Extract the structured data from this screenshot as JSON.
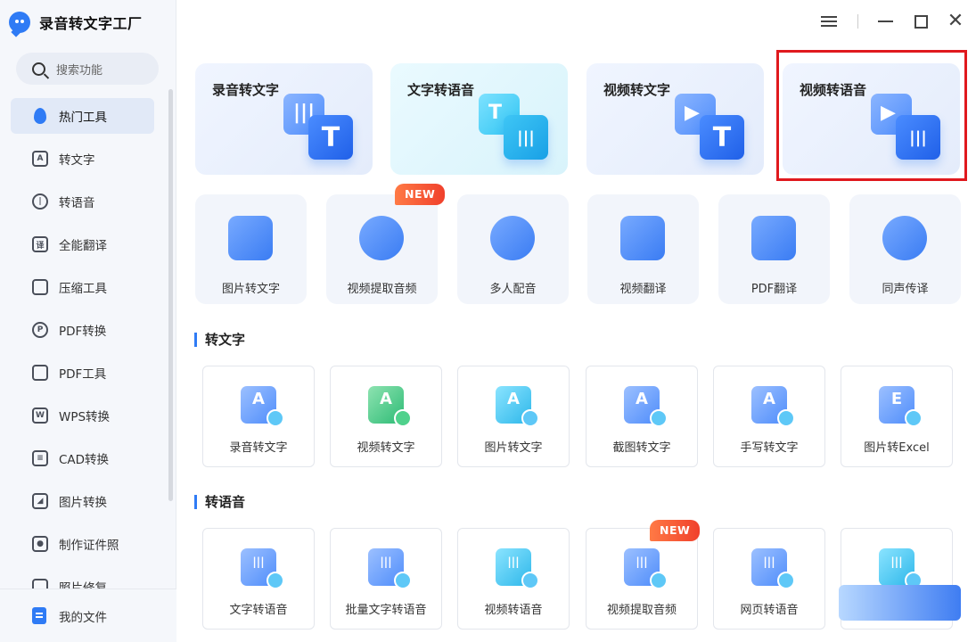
{
  "app": {
    "name": "录音转文字工厂"
  },
  "search": {
    "placeholder": "搜索功能"
  },
  "sidebar": {
    "items": [
      {
        "label": "热门工具",
        "icon": "fire-icon",
        "active": true
      },
      {
        "label": "转文字",
        "icon": "text-convert-icon"
      },
      {
        "label": "转语音",
        "icon": "voice-convert-icon"
      },
      {
        "label": "全能翻译",
        "icon": "translate-icon"
      },
      {
        "label": "压缩工具",
        "icon": "compress-icon"
      },
      {
        "label": "PDF转换",
        "icon": "pdf-convert-icon"
      },
      {
        "label": "PDF工具",
        "icon": "pdf-toolbox-icon"
      },
      {
        "label": "WPS转换",
        "icon": "wps-icon"
      },
      {
        "label": "CAD转换",
        "icon": "cad-icon"
      },
      {
        "label": "图片转换",
        "icon": "image-convert-icon"
      },
      {
        "label": "制作证件照",
        "icon": "id-photo-icon"
      },
      {
        "label": "照片修复",
        "icon": "photo-repair-icon"
      }
    ],
    "bottom": {
      "label": "我的文件",
      "icon": "my-files-icon"
    }
  },
  "hero_cards": [
    {
      "title": "录音转文字",
      "back_glyph": "|||",
      "front_glyph": "T",
      "theme": "blue"
    },
    {
      "title": "文字转语音",
      "back_glyph": "T",
      "front_glyph": "|||",
      "theme": "cyan"
    },
    {
      "title": "视频转文字",
      "back_glyph": "▶",
      "front_glyph": "T",
      "theme": "blue"
    },
    {
      "title": "视频转语音",
      "back_glyph": "▶",
      "front_glyph": "|||",
      "theme": "blue",
      "highlighted": true
    }
  ],
  "tools": [
    {
      "label": "图片转文字",
      "icon": "image-to-text-icon"
    },
    {
      "label": "视频提取音频",
      "icon": "extract-audio-icon",
      "badge": "NEW"
    },
    {
      "label": "多人配音",
      "icon": "multi-voice-icon"
    },
    {
      "label": "视频翻译",
      "icon": "video-translate-icon"
    },
    {
      "label": "PDF翻译",
      "icon": "pdf-translate-icon"
    },
    {
      "label": "同声传译",
      "icon": "simultaneous-interpret-icon"
    }
  ],
  "sections": [
    {
      "title": "转文字",
      "cards": [
        {
          "label": "录音转文字",
          "glyph": "A",
          "theme": "blue"
        },
        {
          "label": "视频转文字",
          "glyph": "A",
          "theme": "green"
        },
        {
          "label": "图片转文字",
          "glyph": "A",
          "theme": "cyan"
        },
        {
          "label": "截图转文字",
          "glyph": "A",
          "theme": "blue"
        },
        {
          "label": "手写转文字",
          "glyph": "A",
          "theme": "blue"
        },
        {
          "label": "图片转Excel",
          "glyph": "E",
          "theme": "blue"
        }
      ]
    },
    {
      "title": "转语音",
      "cards": [
        {
          "label": "文字转语音",
          "glyph": "|||",
          "theme": "blue"
        },
        {
          "label": "批量文字转语音",
          "glyph": "|||",
          "theme": "blue"
        },
        {
          "label": "视频转语音",
          "glyph": "|||",
          "theme": "cyan"
        },
        {
          "label": "视频提取音频",
          "glyph": "|||",
          "theme": "blue",
          "badge": "NEW"
        },
        {
          "label": "网页转语音",
          "glyph": "|||",
          "theme": "blue"
        },
        {
          "label": "",
          "glyph": "|||",
          "theme": "cyan"
        }
      ]
    }
  ],
  "colors": {
    "accent": "#2f7bf5",
    "badge": "#f0402c",
    "highlight": "#e0191e",
    "sidebar_bg": "#f5f7fb"
  }
}
